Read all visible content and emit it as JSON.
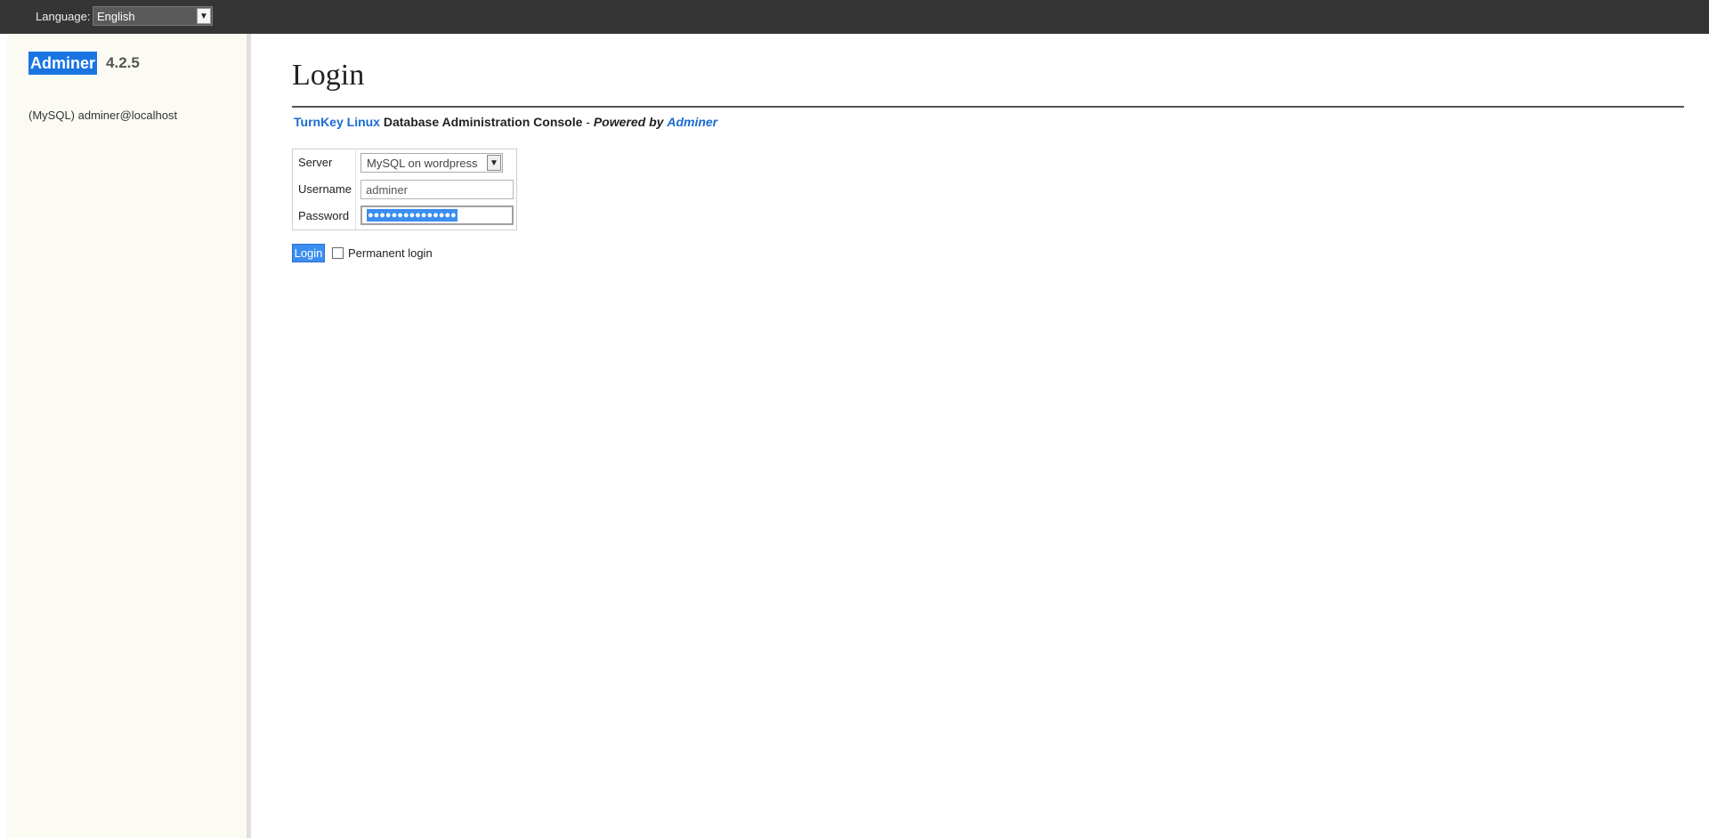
{
  "topbar": {
    "language_label": "Language:",
    "language_value": "English"
  },
  "sidebar": {
    "brand": "Adminer",
    "version": "4.2.5",
    "connection": "(MySQL) adminer@localhost"
  },
  "main": {
    "title": "Login",
    "subline": {
      "turnkey": "TurnKey Linux",
      "console": "Database Administration Console",
      "separator": " - ",
      "powered_by": "Powered by",
      "adminer": "Adminer"
    },
    "form": {
      "server_label": "Server",
      "server_value": "MySQL on wordpress",
      "username_label": "Username",
      "username_value": "adminer",
      "password_label": "Password",
      "password_masked": "●●●●●●●●●●●●●●●"
    },
    "login_button": "Login",
    "permanent_label": "Permanent login"
  },
  "colors": {
    "accent": "#3b8ef0",
    "brand": "#1a75e2",
    "topbar": "#353535",
    "sidebar": "#fbfaf3"
  }
}
